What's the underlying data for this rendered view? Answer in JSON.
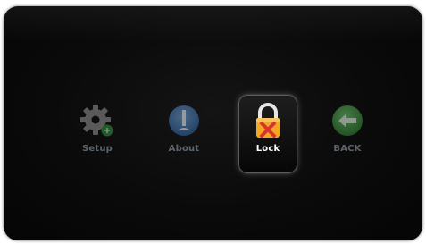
{
  "menu": {
    "items": [
      {
        "label": "Setup",
        "icon": "gear-icon",
        "selected": false
      },
      {
        "label": "About",
        "icon": "info-icon",
        "selected": false
      },
      {
        "label": "Lock",
        "icon": "padlock-icon",
        "selected": true
      },
      {
        "label": "BACK",
        "icon": "back-arrow-icon",
        "selected": false
      }
    ]
  },
  "colors": {
    "background": "#0a0a0a",
    "label_inactive": "#8f9aa5",
    "label_active": "#ffffff",
    "gear": "#8c8c8c",
    "gear_badge": "#2e8b3a",
    "info": "#3b6fa8",
    "lock_body": "#f2a823",
    "lock_mark": "#d9342b",
    "back": "#3c8f3f"
  }
}
